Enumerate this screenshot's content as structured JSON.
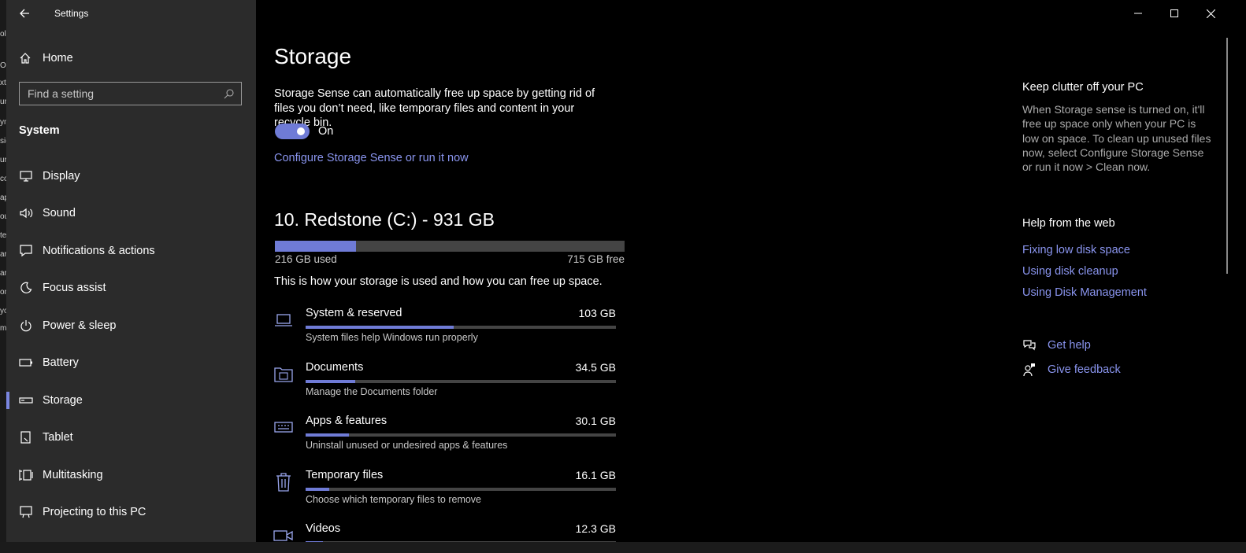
{
  "background_strip": [
    "ol",
    "Ob",
    "xt",
    "ur",
    "yn",
    "sic",
    "ur",
    "co",
    "ap",
    "ou",
    "te",
    "arz",
    "ar",
    "on",
    "yo",
    "m"
  ],
  "window": {
    "title": "Settings"
  },
  "sidebar": {
    "home_label": "Home",
    "search_placeholder": "Find a setting",
    "section_title": "System",
    "items": [
      {
        "label": "Display",
        "icon": "monitor-icon"
      },
      {
        "label": "Sound",
        "icon": "speaker-icon"
      },
      {
        "label": "Notifications & actions",
        "icon": "message-icon"
      },
      {
        "label": "Focus assist",
        "icon": "moon-icon"
      },
      {
        "label": "Power & sleep",
        "icon": "power-icon"
      },
      {
        "label": "Battery",
        "icon": "battery-icon"
      },
      {
        "label": "Storage",
        "icon": "drive-icon",
        "active": true
      },
      {
        "label": "Tablet",
        "icon": "tablet-icon"
      },
      {
        "label": "Multitasking",
        "icon": "multitasking-icon"
      },
      {
        "label": "Projecting to this PC",
        "icon": "projecting-icon"
      }
    ]
  },
  "main": {
    "title": "Storage",
    "description": "Storage Sense can automatically free up space by getting rid of files you don’t need, like temporary files and content in your recycle bin.",
    "toggle": {
      "state": "On",
      "on": true
    },
    "configure_link": "Configure Storage Sense or run it now",
    "drive": {
      "title": "10. Redstone (C:) - 931 GB",
      "used_label": "216 GB used",
      "free_label": "715 GB free",
      "used_fraction": 0.232
    },
    "how_used_text": "This is how your storage is used and how you can free up space.",
    "categories": [
      {
        "name": "System & reserved",
        "size": "103 GB",
        "sub": "System files help Windows run properly",
        "fraction": 0.477,
        "icon": "laptop-icon"
      },
      {
        "name": "Documents",
        "size": "34.5 GB",
        "sub": "Manage the Documents folder",
        "fraction": 0.16,
        "icon": "documents-folder-icon"
      },
      {
        "name": "Apps & features",
        "size": "30.1 GB",
        "sub": "Uninstall unused or undesired apps & features",
        "fraction": 0.14,
        "icon": "keyboard-icon"
      },
      {
        "name": "Temporary files",
        "size": "16.1 GB",
        "sub": "Choose which temporary files to remove",
        "fraction": 0.075,
        "icon": "trash-icon"
      },
      {
        "name": "Videos",
        "size": "12.3 GB",
        "sub": "",
        "fraction": 0.057,
        "icon": "video-icon"
      }
    ]
  },
  "right_panel": {
    "keep_title": "Keep clutter off your PC",
    "keep_text": "When Storage sense is turned on, it'll free up space only when your PC is low on space. To clean up unused files now, select Configure Storage Sense or run it now > Clean now.",
    "help_title": "Help from the web",
    "links": [
      "Fixing low disk space",
      "Using disk cleanup",
      "Using Disk Management"
    ],
    "get_help": "Get help",
    "give_feedback": "Give feedback"
  },
  "colors": {
    "accent": "#6f7bd6",
    "link": "#8a95ef",
    "sidebar_bg": "#2b2b2b"
  }
}
